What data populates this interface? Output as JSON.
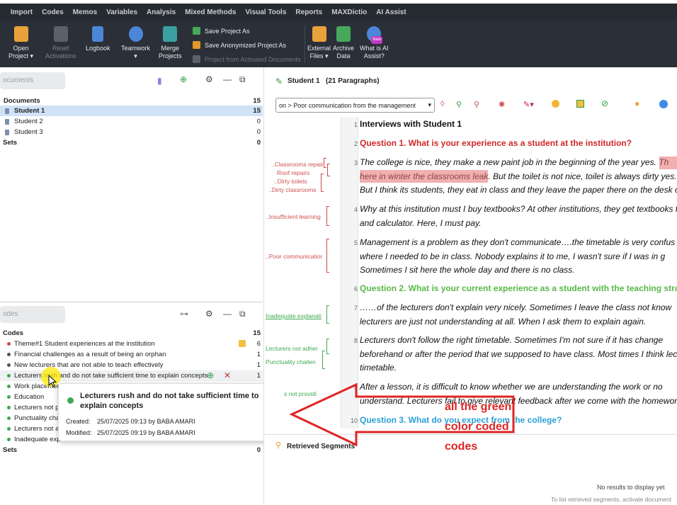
{
  "menu": [
    "Import",
    "Codes",
    "Memos",
    "Variables",
    "Analysis",
    "Mixed Methods",
    "Visual Tools",
    "Reports",
    "MAXDictio",
    "AI Assist"
  ],
  "ribbon": {
    "open_project": [
      "Open",
      "Project"
    ],
    "reset_activations": [
      "Reset",
      "Activations"
    ],
    "logbook": "Logbook",
    "teamwork": "Teamwork",
    "merge_projects": [
      "Merge",
      "Projects"
    ],
    "save_project_as": "Save Project As",
    "save_anonymized": "Save Anonymized Project As",
    "project_from_activated": "Project from Activated Documents",
    "external_files": [
      "External",
      "Files"
    ],
    "archive_data": [
      "Archive",
      "Data"
    ],
    "ai_assist": [
      "What is AI",
      "Assist?"
    ],
    "new_badge": "New",
    "accent": "#e09a2a"
  },
  "documents": {
    "search_placeholder": "ocuments",
    "rows": [
      {
        "name": "Documents",
        "count": "15"
      },
      {
        "name": "Student 1",
        "count": "15"
      },
      {
        "name": "Student 2",
        "count": "0"
      },
      {
        "name": "Student 3",
        "count": "0"
      },
      {
        "name": "Sets",
        "count": "0"
      }
    ]
  },
  "codes": {
    "search_placeholder": "odes",
    "rows": [
      {
        "name": "Codes",
        "count": "15"
      },
      {
        "name": "Theme#1 Student experiences at the institution",
        "count": "6",
        "color": "#d04848"
      },
      {
        "name": "Financial challenges as a result of being an orphan",
        "count": "1",
        "color": "#555555"
      },
      {
        "name": "New lecturers that are not able to teach effectively",
        "count": "1",
        "color": "#555555"
      },
      {
        "name": "Lecturers rush and do not take sufficient time to explain concepts",
        "count": "1",
        "color": "#40a850"
      },
      {
        "name": "Work placement",
        "count": "",
        "color": "#40a850"
      },
      {
        "name": "Education",
        "count": "",
        "color": "#40a850"
      },
      {
        "name": "Lecturers not pr",
        "count": "",
        "color": "#40a850"
      },
      {
        "name": "Punctuality cha",
        "count": "",
        "color": "#40a850"
      },
      {
        "name": "Lecturers not ac",
        "count": "",
        "color": "#40a850"
      },
      {
        "name": "Inadequate expl",
        "count": "",
        "color": "#40a850"
      },
      {
        "name": "Sets",
        "count": "0"
      }
    ]
  },
  "tooltip": {
    "title": "Lecturers rush and do not take sufficient time to explain concepts",
    "created_label": "Created:",
    "created": "25/07/2025 09:13 by BABA AMARI",
    "modified_label": "Modified:",
    "modified": "25/07/2025 09:19 by BABA AMARI"
  },
  "document_browser": {
    "title": "Student 1",
    "para_count": "(21 Paragraphs)",
    "filter_value": "on > Poor communication from the management",
    "ellipsis": "...",
    "paragraphs": [
      {
        "n": "1",
        "lines": [
          "Interviews with Student 1"
        ],
        "style": "heading-black"
      },
      {
        "n": "2",
        "lines": [
          "Question 1. What is your experience as a student at the institution?"
        ],
        "style": "heading-red"
      },
      {
        "n": "3",
        "lines": [
          "The college is nice, they make a new paint job in the beginning of the year yes. Th",
          "here in winter the classrooms leak. But the toilet is not nice, toilet is always dirty yes. A",
          "But I think its students, they eat in class and they leave the paper there on the desk or"
        ],
        "style": "italic"
      },
      {
        "n": "4",
        "lines": [
          "Why at this institution must I buy textbooks? At other institutions, they get textbooks fo",
          "and calculator. Here, I must pay."
        ],
        "style": "italic"
      },
      {
        "n": "5",
        "lines": [
          " Management is a problem as they don't communicate….the timetable is very confus",
          "where I needed to be in class. Nobody explains it to me, I wasn't sure if I was in g",
          "Sometimes I sit here the whole day and there is no class."
        ],
        "style": "italic"
      },
      {
        "n": "6",
        "lines": [
          "Question 2. What is your current experience as a student with the teaching strat"
        ],
        "style": "heading-green"
      },
      {
        "n": "7",
        "lines": [
          "……of the lecturers don't explain very nicely. Sometimes I leave the class not know",
          "lecturers are just not understanding at all. When I ask them to explain again."
        ],
        "style": "italic"
      },
      {
        "n": "8",
        "lines": [
          "Lecturers don't follow the right timetable. Sometimes I'm not sure if it has change",
          "beforehand or after the period that we supposed to have class. Most times I think lect",
          "timetable."
        ],
        "style": "italic"
      },
      {
        "n": "9",
        "lines": [
          "After a lesson, it is difficult to know whether we are understanding the work or no",
          "understand. Lecturers fail to give relevant feedback after we come with the homework"
        ],
        "style": "italic"
      },
      {
        "n": "10",
        "lines": [
          "Question 3. What do you expect from the college?"
        ],
        "style": "heading-blue"
      }
    ],
    "code_labels": [
      {
        "text": "..Classrooms repair",
        "color": "red"
      },
      {
        "text": "Roof repairs",
        "color": "red"
      },
      {
        "text": "..Dirty toilets",
        "color": "red"
      },
      {
        "text": "..Dirty classrooms",
        "color": "red"
      },
      {
        "text": "..Insufficient learning",
        "color": "red"
      },
      {
        "text": "..Poor communicatior",
        "color": "red"
      },
      {
        "text": "Inadequate explanati",
        "color": "green"
      },
      {
        "text": "Lecturers not adher",
        "color": "green"
      },
      {
        "text": "Punctuality challen",
        "color": "green"
      },
      {
        "text": "s not providi",
        "color": "green"
      }
    ],
    "retrieved_title": "Retrieved Segments",
    "no_results": "No results to display yet",
    "hint": "To list retrieved segments, activate document"
  },
  "annotation": {
    "text_lines": [
      "all the green",
      "color coded",
      "codes"
    ],
    "color": "#e02424"
  }
}
